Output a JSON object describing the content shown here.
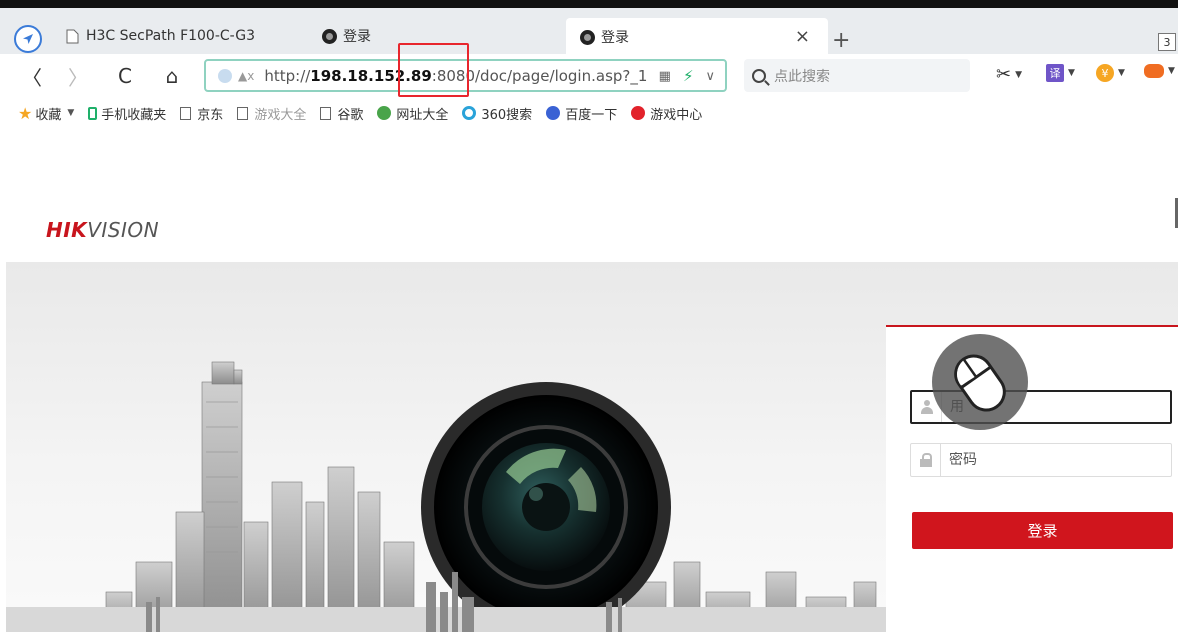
{
  "browser": {
    "tabs": [
      {
        "title": "H3C SecPath F100-C-G3"
      },
      {
        "title": "登录"
      },
      {
        "title": "登录",
        "active": true
      }
    ],
    "tab_close": "×",
    "new_tab": "+",
    "tab_count": "3"
  },
  "nav": {
    "back": "〈",
    "forward": "〉",
    "reload": "C",
    "home": "⌂",
    "address": {
      "prefix": "http://",
      "host": "198.18.152.89",
      "rest": ":8080/doc/page/login.asp?_1"
    },
    "search_placeholder": "点此搜索"
  },
  "bookmarks": {
    "items": [
      "收藏",
      "手机收藏夹",
      "京东",
      "游戏大全",
      "谷歌",
      "网址大全",
      "360搜索",
      "百度一下",
      "游戏中心"
    ]
  },
  "page": {
    "logo_red": "HIK",
    "logo_grey": "VISION",
    "login": {
      "username_placeholder": "用",
      "password_placeholder": "密码",
      "login_button": "登录"
    }
  },
  "colors": {
    "brand_red": "#c8151d",
    "button_red": "#d0151d",
    "highlight": "#e8262d",
    "address_border": "#8fd2c0"
  }
}
